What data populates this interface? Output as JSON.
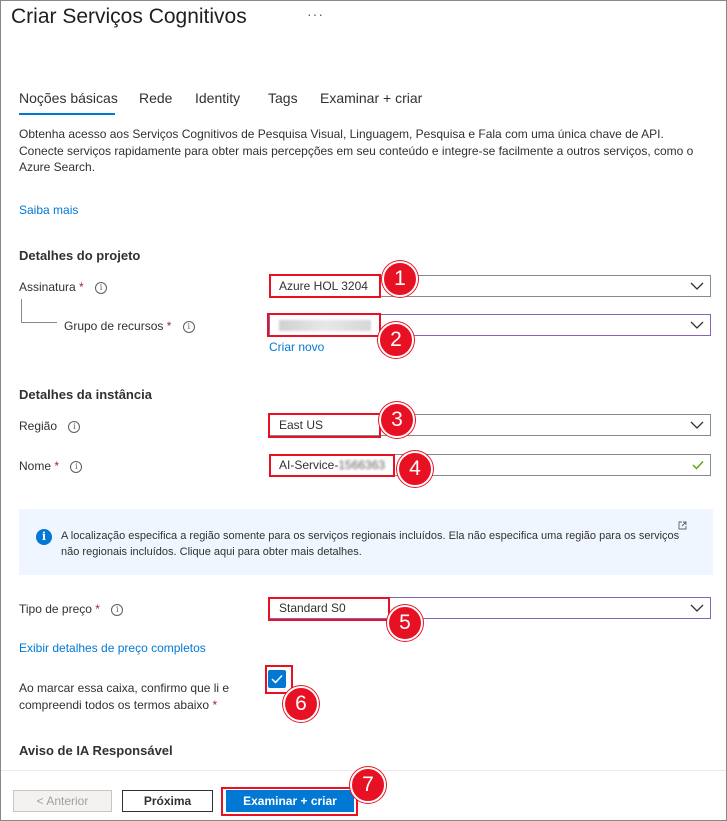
{
  "header": {
    "title": "Criar Serviços Cognitivos",
    "more_label": "···"
  },
  "tabs": [
    {
      "label": "Noções básicas",
      "active": true
    },
    {
      "label": "Rede"
    },
    {
      "label": "Identity"
    },
    {
      "label": "Tags"
    },
    {
      "label": "Examinar + criar"
    }
  ],
  "intro": {
    "description": "Obtenha acesso aos Serviços Cognitivos de Pesquisa Visual, Linguagem, Pesquisa e Fala com uma única chave de API. Conecte serviços rapidamente para obter mais percepções em seu conteúdo e integre-se facilmente a outros serviços, como o Azure Search.",
    "learn_more": "Saiba mais"
  },
  "project_details": {
    "heading": "Detalhes do projeto",
    "subscription": {
      "label": "Assinatura",
      "required": "*",
      "value": "Azure HOL 3204"
    },
    "resource_group": {
      "label": "Grupo de recursos",
      "required": "*",
      "value": "",
      "create_new": "Criar novo"
    }
  },
  "instance_details": {
    "heading": "Detalhes da instância",
    "region": {
      "label": "Região",
      "value": "East US"
    },
    "name": {
      "label": "Nome",
      "required": "*",
      "value": "AI-Service-",
      "value_obscured": "1566363"
    }
  },
  "info_banner": {
    "text": "A localização especifica a região somente para os serviços regionais incluídos. Ela não especifica uma região para os serviços não regionais incluídos. Clique aqui para obter mais detalhes."
  },
  "pricing": {
    "label": "Tipo de preço",
    "required": "*",
    "value": "Standard S0",
    "details_link": "Exibir detalhes de preço completos"
  },
  "terms": {
    "label_line1": "Ao marcar essa caixa, confirmo que li e",
    "label_line2": "compreendi todos os termos abaixo",
    "required": "*",
    "checked": true
  },
  "responsible_ai": {
    "heading": "Aviso de IA Responsável"
  },
  "footer": {
    "previous": "< Anterior",
    "next": "Próxima",
    "review_create": "Examinar + criar"
  },
  "callouts": [
    "1",
    "2",
    "3",
    "4",
    "5",
    "6",
    "7"
  ],
  "colors": {
    "accent": "#0078d4",
    "highlight": "#e81123",
    "required": "#a4262c",
    "valid": "#57a300"
  }
}
